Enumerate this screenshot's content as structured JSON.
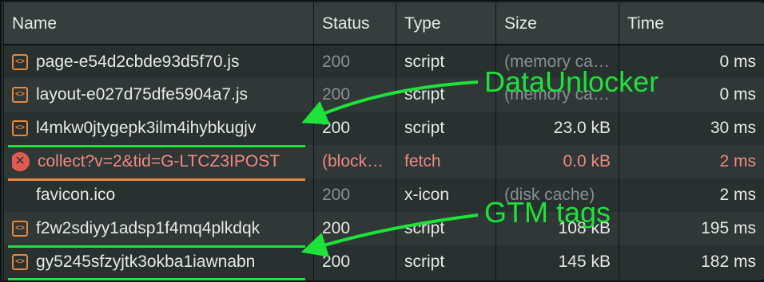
{
  "columns": {
    "name": "Name",
    "status": "Status",
    "type": "Type",
    "size": "Size",
    "time": "Time"
  },
  "rows": [
    {
      "icon": "script-icon",
      "name": "page-e54d2cbde93d5f70.js",
      "status": "200",
      "type": "script",
      "size": "(memory cache)",
      "time": "0 ms",
      "status_dim": true,
      "size_dim": true
    },
    {
      "icon": "script-icon",
      "name": "layout-e027d75dfe5904a7.js",
      "status": "200",
      "type": "script",
      "size": "(memory cache)",
      "time": "0 ms",
      "status_dim": true,
      "size_dim": true
    },
    {
      "icon": "script-icon",
      "name": "l4mkw0jtygepk3ilm4ihybkugjv",
      "status": "200",
      "type": "script",
      "size": "23.0 kB",
      "time": "30 ms"
    },
    {
      "icon": "error-icon",
      "name": "collect?v=2&tid=G-LTCZ3IPOST",
      "status": "(blocked)",
      "type": "fetch",
      "size": "0.0 kB",
      "time": "2 ms",
      "error": true
    },
    {
      "icon": "none",
      "name": "favicon.ico",
      "status": "200",
      "type": "x-icon",
      "size": "(disk cache)",
      "time": "2 ms",
      "status_dim": true,
      "size_dim": true
    },
    {
      "icon": "script-icon",
      "name": "f2w2sdiyy1adsp1f4mq4plkdqk",
      "status": "200",
      "type": "script",
      "size": "108 kB",
      "time": "195 ms"
    },
    {
      "icon": "script-icon",
      "name": "gy5245sfzyjtk3okba1iawnabn",
      "status": "200",
      "type": "script",
      "size": "145 kB",
      "time": "182 ms"
    }
  ],
  "annotations": {
    "top_label": "DataUnlocker",
    "bottom_label": "GTM tags",
    "green": "#1ee23a",
    "orange": "#e8873e"
  }
}
